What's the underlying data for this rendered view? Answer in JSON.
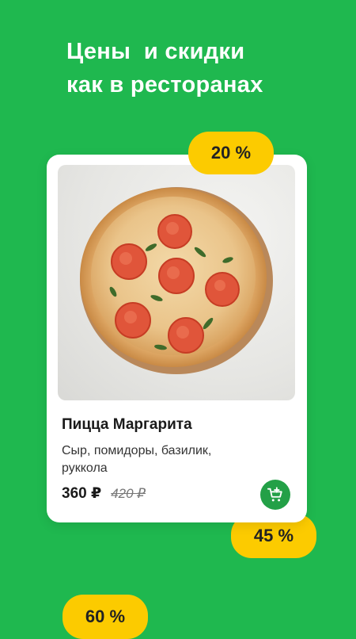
{
  "promo": {
    "headline_line1": "Цены  и скидки",
    "headline_line2": "как в ресторанах"
  },
  "badges": [
    "20 %",
    "45 %",
    "60 %"
  ],
  "product": {
    "image_subject": "pizza-margherita-photo",
    "title": "Пицца Маргарита",
    "description": "Сыр, помидоры, базилик, руккола",
    "price": "360 ₽",
    "old_price": "420 ₽",
    "cart_icon": "cart-add-icon"
  },
  "colors": {
    "background": "#1FB84F",
    "badge": "#FCCB00",
    "cart_button": "#23A047",
    "card": "#FFFFFF"
  }
}
